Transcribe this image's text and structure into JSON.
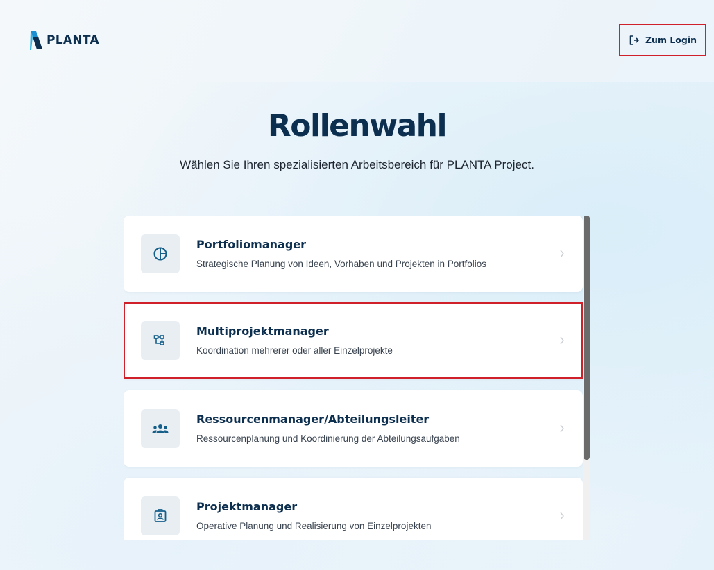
{
  "brand": {
    "logo_text": "PLANTA"
  },
  "header": {
    "login_label": "Zum Login"
  },
  "page": {
    "title": "Rollenwahl",
    "subtitle": "Wählen Sie Ihren spezialisierten Arbeitsbereich für PLANTA Project."
  },
  "roles": [
    {
      "title": "Portfoliomanager",
      "description": "Strategische Planung von Ideen, Vorhaben und Projekten in Portfolios",
      "icon": "pie-chart-icon"
    },
    {
      "title": "Multiprojektmanager",
      "description": "Koordination mehrerer oder aller Einzelprojekte",
      "icon": "hierarchy-icon"
    },
    {
      "title": "Ressourcenmanager/Abteilungsleiter",
      "description": "Ressourcenplanung und Koordinierung der Abteilungsaufgaben",
      "icon": "team-icon"
    },
    {
      "title": "Projektmanager",
      "description": "Operative Planung und Realisierung von Einzelprojekten",
      "icon": "id-badge-icon"
    }
  ],
  "colors": {
    "brand_navy": "#0d2f4f",
    "icon_blue": "#145e8a",
    "highlight_red": "#d0202a",
    "icon_box_bg": "#e9eef3"
  }
}
